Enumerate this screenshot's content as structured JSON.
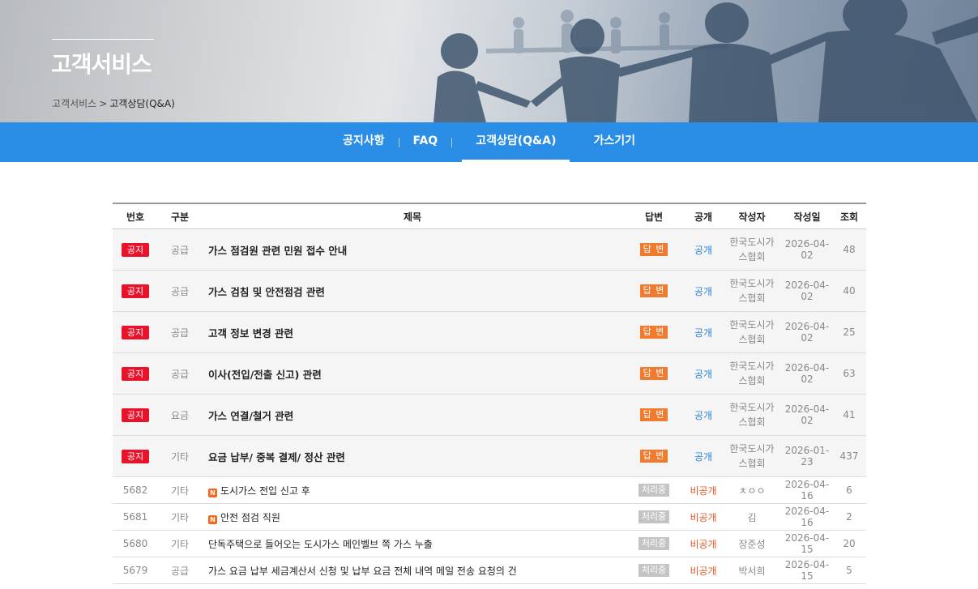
{
  "hero": {
    "title": "고객서비스",
    "breadcrumb": [
      "고객서비스",
      "고객상담(Q&A)"
    ],
    "breadcrumb_sep": ">"
  },
  "nav": {
    "tabs": [
      {
        "label": "공지사항",
        "active": false
      },
      {
        "label": "FAQ",
        "active": false
      },
      {
        "label": "고객상담(Q&A)",
        "active": true
      },
      {
        "label": "가스기기",
        "active": false
      }
    ]
  },
  "table": {
    "headers": [
      "번호",
      "구분",
      "제목",
      "답변",
      "공개",
      "작성자",
      "작성일",
      "조회"
    ],
    "notices": [
      {
        "badge": "공지",
        "category": "공급",
        "title": "가스 점검원 관련 민원 접수 안내",
        "answer": "답 변",
        "visibility": "공개",
        "author_line1": "한국도시가",
        "author_line2": "스협회",
        "date": "2026-04-02",
        "views": "48"
      },
      {
        "badge": "공지",
        "category": "공급",
        "title": "가스 검침 및 안전점검 관련",
        "answer": "답 변",
        "visibility": "공개",
        "author_line1": "한국도시가",
        "author_line2": "스협회",
        "date": "2026-04-02",
        "views": "40"
      },
      {
        "badge": "공지",
        "category": "공급",
        "title": "고객 정보 변경 관련",
        "answer": "답 변",
        "visibility": "공개",
        "author_line1": "한국도시가",
        "author_line2": "스협회",
        "date": "2026-04-02",
        "views": "25"
      },
      {
        "badge": "공지",
        "category": "공급",
        "title": "이사(전입/전출 신고) 관련",
        "answer": "답 변",
        "visibility": "공개",
        "author_line1": "한국도시가",
        "author_line2": "스협회",
        "date": "2026-04-02",
        "views": "63"
      },
      {
        "badge": "공지",
        "category": "요금",
        "title": "가스 연결/철거 관련",
        "answer": "답 변",
        "visibility": "공개",
        "author_line1": "한국도시가",
        "author_line2": "스협회",
        "date": "2026-04-02",
        "views": "41"
      },
      {
        "badge": "공지",
        "category": "기타",
        "title": "요금 납부/ 중복 결제/ 정산 관련",
        "answer": "답 변",
        "visibility": "공개",
        "author_line1": "한국도시가",
        "author_line2": "스협회",
        "date": "2026-01-23",
        "views": "437"
      }
    ],
    "posts": [
      {
        "no": "5682",
        "category": "기타",
        "new": "N",
        "title": "도시가스 전입 신고 후",
        "answer": "처리중",
        "visibility": "비공개",
        "author": "ㅊㅇㅇ",
        "date": "2026-04-16",
        "views": "6"
      },
      {
        "no": "5681",
        "category": "기타",
        "new": "N",
        "title": "안전 점검 직원",
        "answer": "처리중",
        "visibility": "비공개",
        "author": "김",
        "date": "2026-04-16",
        "views": "2"
      },
      {
        "no": "5680",
        "category": "기타",
        "new": "",
        "title": "단독주택으로 들어오는 도시가스 메인벨브 쪽 가스 누출",
        "answer": "처리중",
        "visibility": "비공개",
        "author": "장준성",
        "date": "2026-04-15",
        "views": "20"
      },
      {
        "no": "5679",
        "category": "공급",
        "new": "",
        "title": "가스 요금 납부 세금계산서 신청 및 납부 요금 전체 내역 메일 전송 요청의 건",
        "answer": "처리중",
        "visibility": "비공개",
        "author": "박서희",
        "date": "2026-04-15",
        "views": "5"
      }
    ]
  },
  "colors": {
    "nav_bg": "#2a8de6",
    "notice_badge": "#e8132b",
    "answer_badge": "#f07b2e",
    "processing_badge": "#c4c4c4",
    "public_text": "#2a84d8",
    "private_text": "#e8562a"
  }
}
